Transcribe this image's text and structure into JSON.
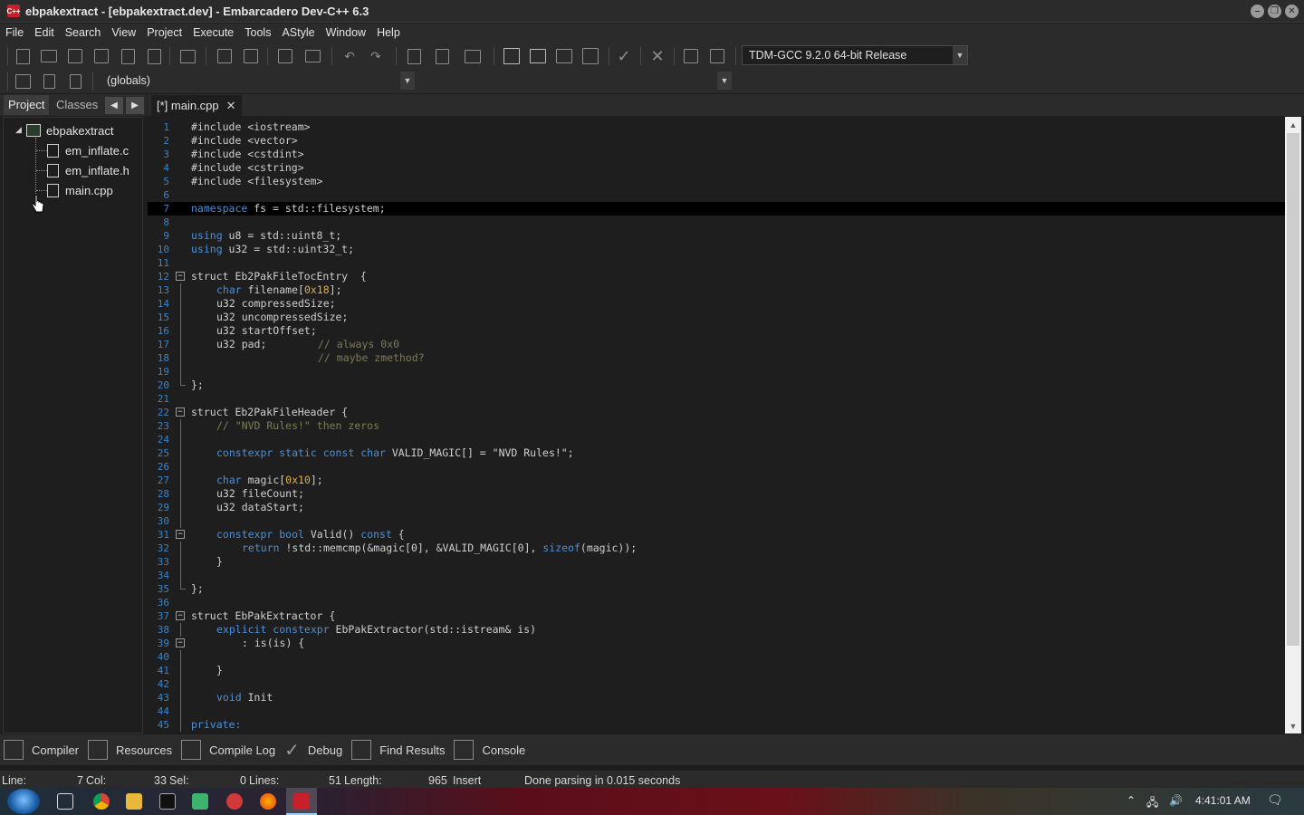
{
  "window": {
    "title": "ebpakextract - [ebpakextract.dev] - Embarcadero Dev-C++ 6.3",
    "icon_label": "C++"
  },
  "menu": [
    "File",
    "Edit",
    "Search",
    "View",
    "Project",
    "Execute",
    "Tools",
    "AStyle",
    "Window",
    "Help"
  ],
  "toolbar": {
    "compiler_select": "TDM-GCC 9.2.0 64-bit Release",
    "scope_select": "(globals)",
    "member_select": ""
  },
  "left_panel": {
    "tabs": [
      "Project",
      "Classes"
    ],
    "project_name": "ebpakextract",
    "files": [
      "em_inflate.c",
      "em_inflate.h",
      "main.cpp"
    ]
  },
  "editor": {
    "tab_label": "[*] main.cpp",
    "lines": [
      "1",
      "2",
      "3",
      "4",
      "5",
      "6",
      "7",
      "8",
      "9",
      "10",
      "11",
      "12",
      "13",
      "14",
      "15",
      "16",
      "17",
      "18",
      "19",
      "20",
      "21",
      "22",
      "23",
      "24",
      "25",
      "26",
      "27",
      "28",
      "29",
      "30",
      "31",
      "32",
      "33",
      "34",
      "35",
      "36",
      "37",
      "38",
      "39",
      "40",
      "41",
      "42",
      "43",
      "44",
      "45"
    ],
    "code": {
      "l1": "#include <iostream>",
      "l2": "#include <vector>",
      "l3": "#include <cstdint>",
      "l4": "#include <cstring>",
      "l5": "#include <filesystem>",
      "l7_kw": "namespace",
      "l7_rest": " fs = std::filesystem;",
      "l9_kw": "using",
      "l9_rest": " u8 = std::uint8_t;",
      "l10_kw": "using",
      "l10_rest": " u32 = std::uint32_t;",
      "l12": "struct Eb2PakFileTocEntry  {",
      "l13_kw": "char",
      "l13_a": " filename[",
      "l13_num": "0x18",
      "l13_b": "];",
      "l14": "u32 compressedSize;",
      "l15": "u32 uncompressedSize;",
      "l16": "u32 startOffset;",
      "l17_code": "u32 pad;",
      "l17_cm": "// always 0x0",
      "l18_cm": "// maybe zmethod?",
      "l20": "};",
      "l22": "struct Eb2PakFileHeader {",
      "l23_cm": "// \"NVD Rules!\" then zeros",
      "l25_kw": "constexpr static const char",
      "l25_a": " VALID_MAGIC[] = ",
      "l25_str": "\"NVD Rules!\"",
      "l25_b": ";",
      "l27_kw": "char",
      "l27_a": " magic[",
      "l27_num": "0x10",
      "l27_b": "];",
      "l28": "u32 fileCount;",
      "l29": "u32 dataStart;",
      "l31_kw": "constexpr bool",
      "l31_a": " Valid() ",
      "l31_kw2": "const",
      "l31_b": " {",
      "l32_kw": "return",
      "l32_a": " !std::memcmp(&magic[0], &VALID_MAGIC[0], ",
      "l32_kw2": "sizeof",
      "l32_b": "(magic));",
      "l33": "}",
      "l35": "};",
      "l37": "struct EbPakExtractor {",
      "l38_kw": "explicit constexpr",
      "l38_a": " EbPakExtractor(std::istream& is)",
      "l39": ": is(is) {",
      "l41": "}",
      "l43_kw": "void",
      "l43_a": " Init",
      "l45_kw": "private:"
    }
  },
  "bottom_tabs": [
    "Compiler",
    "Resources",
    "Compile Log",
    "Debug",
    "Find Results",
    "Console"
  ],
  "status": {
    "line_label": "Line:",
    "line_value": "7",
    "col_label": "Col:",
    "col_value": "33",
    "sel_label": "Sel:",
    "sel_value": "0",
    "lines_label": "Lines:",
    "lines_value": "51",
    "length_label": "Length:",
    "length_value": "965",
    "mode": "Insert",
    "message": "Done parsing in 0.015 seconds"
  },
  "taskbar": {
    "clock": "4:41:01 AM",
    "tray_icons": [
      "chevron-up-icon",
      "network-icon",
      "volume-icon"
    ]
  },
  "colors": {
    "keyword": "#4d8fd6",
    "comment": "#7c7c55",
    "number": "#e2b04c",
    "line_number": "#3a84c9"
  }
}
